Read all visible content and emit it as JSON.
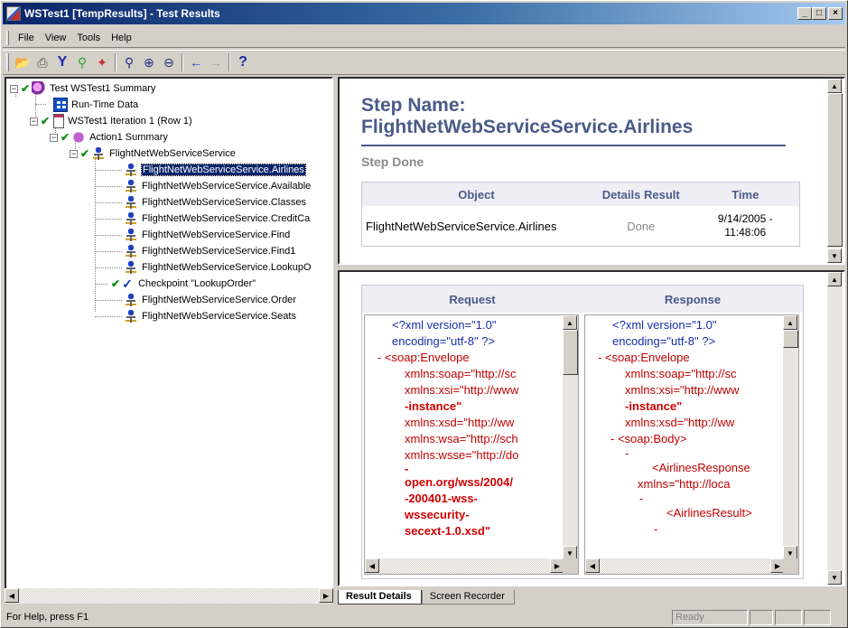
{
  "window": {
    "title": "WSTest1 [TempResults] - Test Results",
    "controls": [
      "_",
      "□",
      "×"
    ]
  },
  "menu": [
    {
      "label": "File"
    },
    {
      "label": "View"
    },
    {
      "label": "Tools"
    },
    {
      "label": "Help"
    }
  ],
  "toolbar": [
    {
      "icon": "open-folder-icon",
      "glyph": "📂"
    },
    {
      "icon": "print-icon",
      "glyph": "🖨"
    },
    {
      "icon": "filter-icon",
      "glyph": "▼"
    },
    {
      "icon": "find-icon",
      "glyph": "🔍"
    },
    {
      "icon": "report-icon",
      "glyph": "🗂"
    },
    {
      "icon": "zoom-fit-icon",
      "glyph": "⛶"
    },
    {
      "icon": "zoom-in-icon",
      "glyph": "⊕"
    },
    {
      "icon": "zoom-out-icon",
      "glyph": "⊖"
    },
    {
      "icon": "back-arrow-icon",
      "glyph": "⇐"
    },
    {
      "icon": "forward-arrow-icon",
      "glyph": "⇒"
    },
    {
      "icon": "help-icon",
      "glyph": "?"
    }
  ],
  "tree": [
    {
      "label": "Test WSTest1 Summary"
    },
    {
      "label": "Run-Time Data"
    },
    {
      "label": "WSTest1 Iteration 1 (Row 1)"
    },
    {
      "label": "Action1 Summary"
    },
    {
      "label": "FlightNetWebServiceService"
    },
    {
      "label": "FlightNetWebServiceService.Airlines"
    },
    {
      "label": "FlightNetWebServiceService.Available"
    },
    {
      "label": "FlightNetWebServiceService.Classes"
    },
    {
      "label": "FlightNetWebServiceService.CreditCa"
    },
    {
      "label": "FlightNetWebServiceService.Find"
    },
    {
      "label": "FlightNetWebServiceService.Find1"
    },
    {
      "label": "FlightNetWebServiceService.LookupO"
    },
    {
      "label": "Checkpoint \"LookupOrder\""
    },
    {
      "label": "FlightNetWebServiceService.Order"
    },
    {
      "label": "FlightNetWebServiceService.Seats"
    }
  ],
  "step": {
    "title_line1": "Step Name:",
    "title_line2": "FlightNetWebServiceService.Airlines",
    "status": "Step Done",
    "columns": [
      "Object",
      "Details",
      "Result",
      "Time"
    ],
    "row": {
      "object": "FlightNetWebServiceService.Airlines",
      "result": "Done",
      "time_line1": "9/14/2005 -",
      "time_line2": "11:48:06"
    }
  },
  "request_response": {
    "request_header": "Request",
    "response_header": "Response",
    "request_lines": [
      "<?xml version=\"1.0\"",
      "encoding=\"utf-8\" ?>",
      "- <soap:Envelope",
      "xmlns:soap=\"http://sc",
      "xmlns:xsi=\"http://www",
      "-instance\"",
      "xmlns:xsd=\"http://ww",
      "xmlns:wsa=\"http://sch",
      "xmlns:wsse=\"http://do",
      "-",
      "open.org/wss/2004/",
      "-200401-wss-",
      "wssecurity-",
      "secext-1.0.xsd\""
    ],
    "response_lines": [
      "<?xml version=\"1.0\"",
      "encoding=\"utf-8\" ?>",
      "- <soap:Envelope",
      "xmlns:soap=\"http://sc",
      "xmlns:xsi=\"http://www",
      "-instance\"",
      "xmlns:xsd=\"http://ww",
      "- <soap:Body>",
      "-",
      "<AirlinesResponse",
      "xmlns=\"http://loca",
      "-",
      "<AirlinesResult>",
      "-"
    ]
  },
  "tabs": [
    {
      "label": "Result Details"
    },
    {
      "label": "Screen Recorder"
    }
  ],
  "status": {
    "text": "For Help, press F1",
    "state": "Ready"
  }
}
